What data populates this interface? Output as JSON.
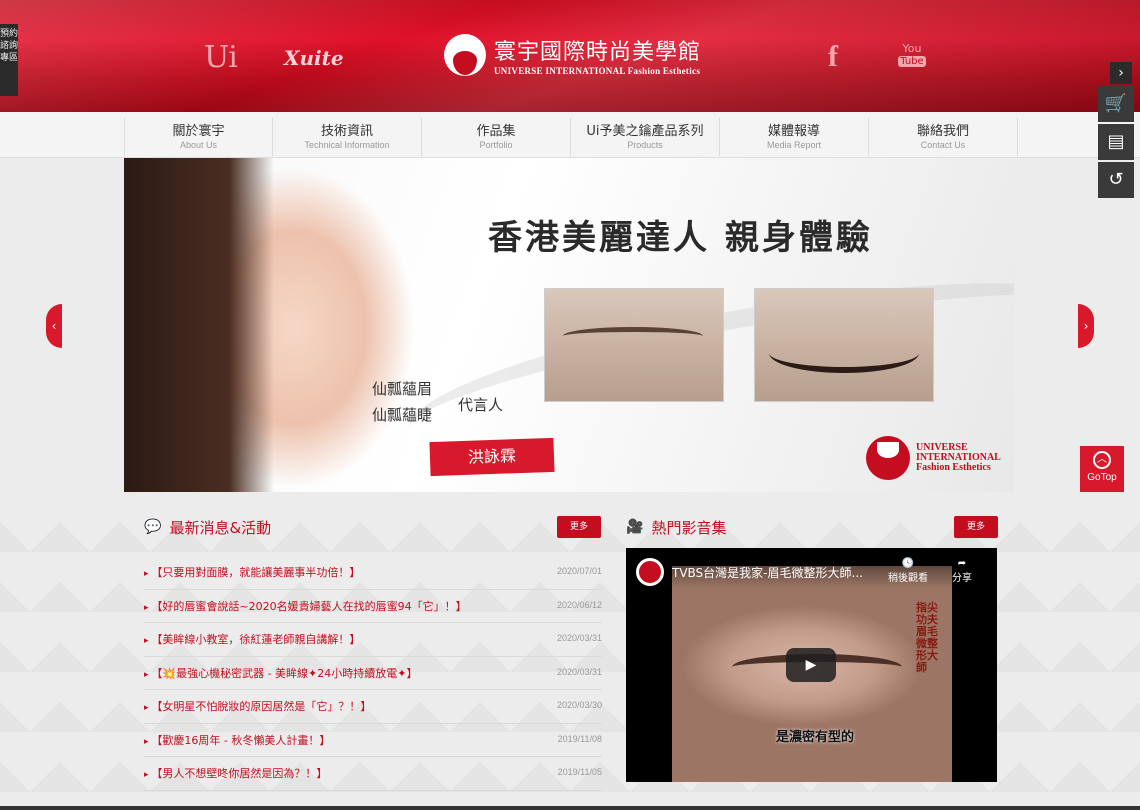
{
  "header": {
    "logo_ui": "Ui",
    "logo_xuite": "Xuite",
    "brand_cn": "寰宇國際時尚美學館",
    "brand_en": "UNIVERSE INTERNATIONAL Fashion Esthetics",
    "facebook": "f",
    "youtube_you": "You",
    "youtube_tube": "Tube"
  },
  "booking_tab": "預約諮詢專區",
  "nav": {
    "items": [
      {
        "zh": "關於寰宇",
        "en": "About Us"
      },
      {
        "zh": "技術資訊",
        "en": "Technical Information"
      },
      {
        "zh": "作品集",
        "en": "Portfolio"
      },
      {
        "zh": "Ui予美之鑰產品系列",
        "en": "Products"
      },
      {
        "zh": "媒體報導",
        "en": "Media Report"
      },
      {
        "zh": "聯絡我們",
        "en": "Contact Us"
      }
    ]
  },
  "banner": {
    "headline": "香港美麗達人 親身體驗",
    "line1": "仙瓢蘊眉",
    "line2": "仙瓢蘊睫",
    "spokes": "代言人",
    "name": "洪詠霖",
    "logo_text1": "UNIVERSE",
    "logo_text2": "INTERNATIONAL",
    "logo_text3": "Fashion Esthetics"
  },
  "gotop": "GoTop",
  "news": {
    "title": "最新消息&活動",
    "more": "更多",
    "items": [
      {
        "title": "【只要用對面膜，就能讓美麗事半功倍！】",
        "date": "2020/07/01"
      },
      {
        "title": "【好的唇蜜會說話~2020名媛貴婦藝人在找的唇蜜94「它」！】",
        "date": "2020/06/12"
      },
      {
        "title": "【美眸線小教室，徐紅蓮老師親自講解！】",
        "date": "2020/03/31"
      },
      {
        "title": "【💥最強心機秘密武器 - 美眸線✦24小時持續放電✦】",
        "date": "2020/03/31"
      },
      {
        "title": "【女明星不怕脫妝的原因居然是「它」？！】",
        "date": "2020/03/30"
      },
      {
        "title": "【歡慶16周年 - 秋冬懶美人計畫！】",
        "date": "2019/11/08"
      },
      {
        "title": "【男人不想壁咚你居然是因為？！】",
        "date": "2019/11/05"
      }
    ]
  },
  "video": {
    "title": "熱門影音集",
    "more": "更多",
    "video_title": "TVBS台灣是我家-眉毛微整形大師...",
    "watch_later": "稍後觀看",
    "share": "分享",
    "caption": "是濃密有型的",
    "overlay_text": "指尖功夫 眉毛微整形大師"
  },
  "colors": {
    "brand_red": "#c40d1e",
    "accent_red": "#d8192c"
  }
}
